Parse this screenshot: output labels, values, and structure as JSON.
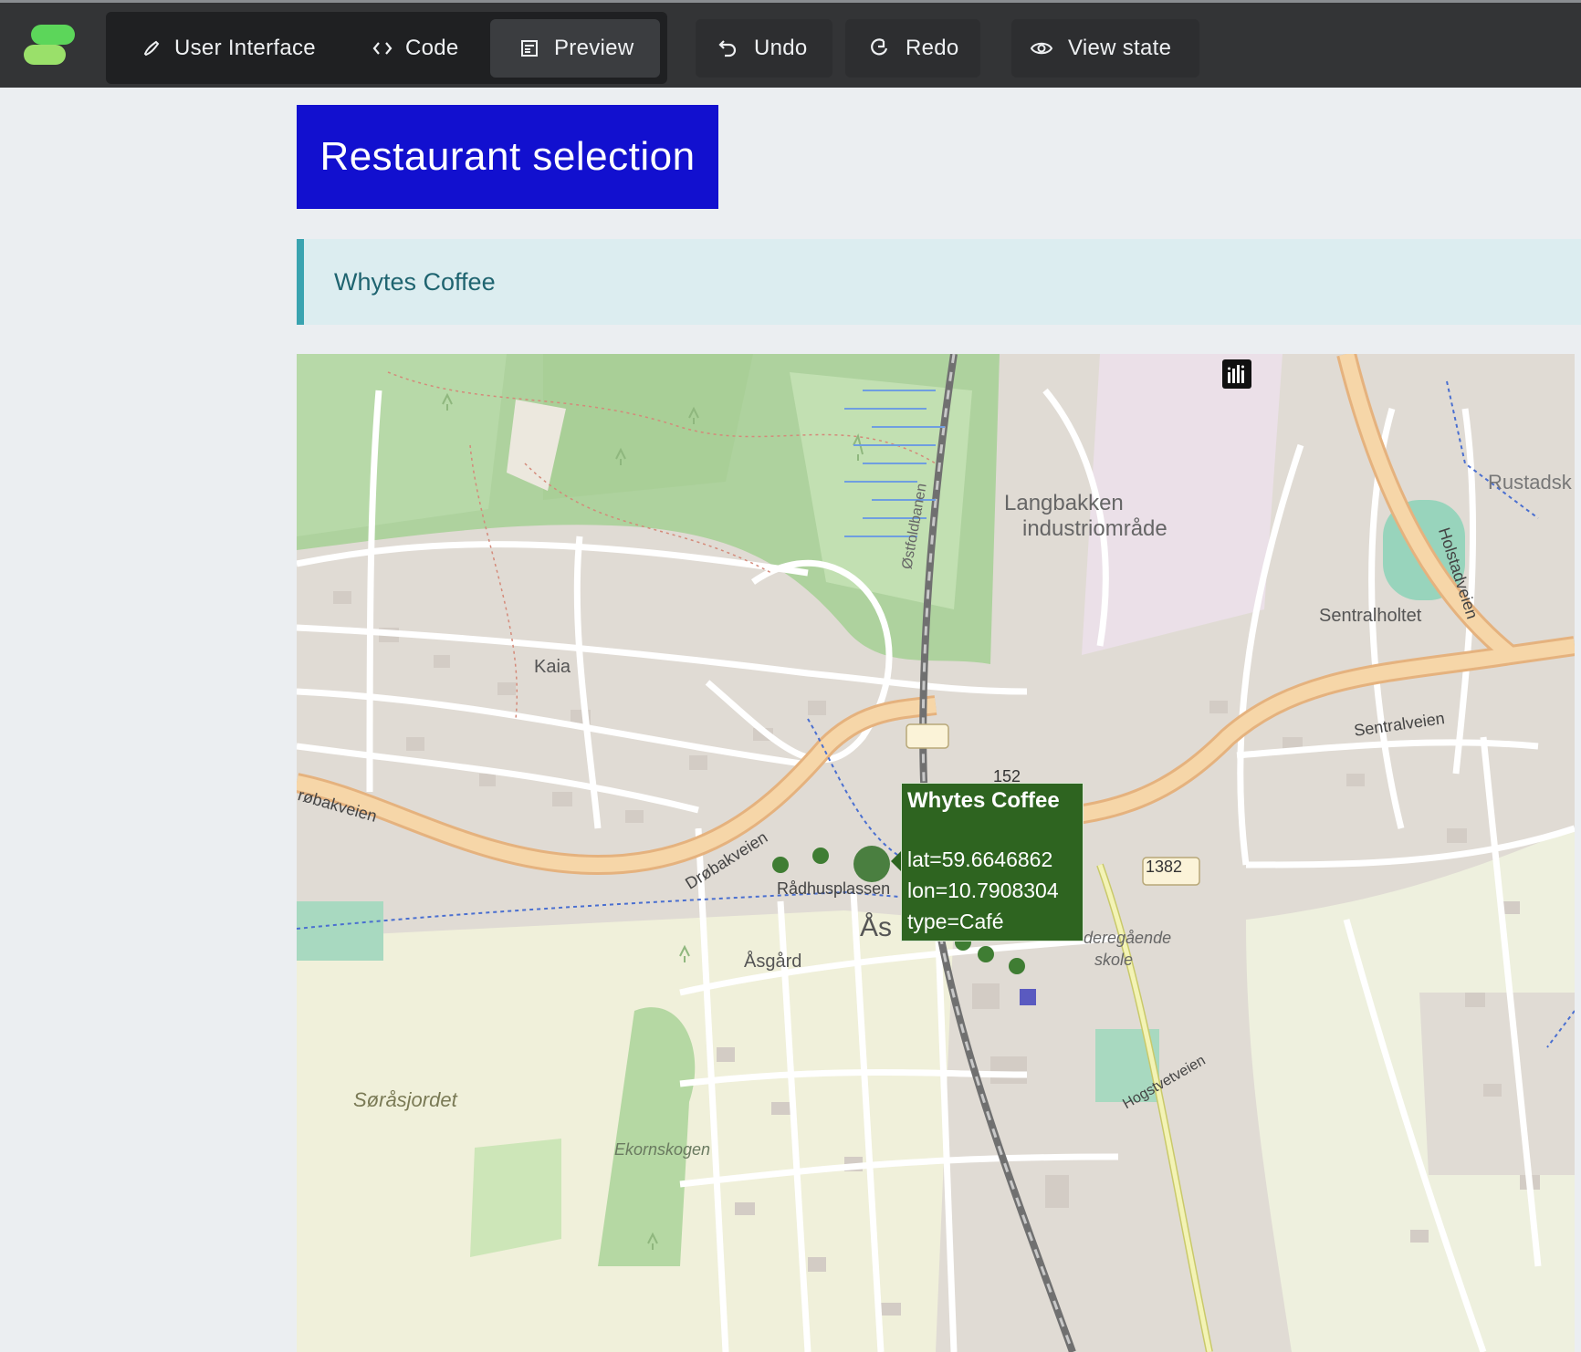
{
  "toolbar": {
    "tabs": [
      {
        "label": "User Interface",
        "icon": "brush-icon"
      },
      {
        "label": "Code",
        "icon": "code-icon"
      },
      {
        "label": "Preview",
        "icon": "preview-icon",
        "active": true
      }
    ],
    "undo_label": "Undo",
    "redo_label": "Redo",
    "view_state_label": "View state"
  },
  "page": {
    "title": "Restaurant selection",
    "selected_name": "Whytes Coffee"
  },
  "map": {
    "tooltip": {
      "title": "Whytes Coffee",
      "lat": "lat=59.6646862",
      "lon": "lon=10.7908304",
      "type": "type=Café"
    },
    "place_labels": {
      "langbakken": "Langbakken",
      "industri": "industriområde",
      "sentralholtet": "Sentralholtet",
      "rustadsk": "Rustadsk",
      "kaia": "Kaia",
      "radhusplassen": "Rådhusplassen",
      "as": "Ås",
      "asgard": "Åsgård",
      "sorasjordet": "Søråsjordet",
      "ekornskogen": "Ekornskogen",
      "videregaende": "deregående",
      "skole": "skole",
      "road_152": "152",
      "road_1382": "1382",
      "drobakveien": "Drøbakveien",
      "sentralveien": "Sentralveien",
      "holstadveien": "Holstadveien",
      "ostfoldbanen": "Østfoldbanen",
      "hogstvetveien": "Hogstvetveien",
      "robakveien": "røbakveien"
    },
    "marker_color": "#3f7d33"
  }
}
